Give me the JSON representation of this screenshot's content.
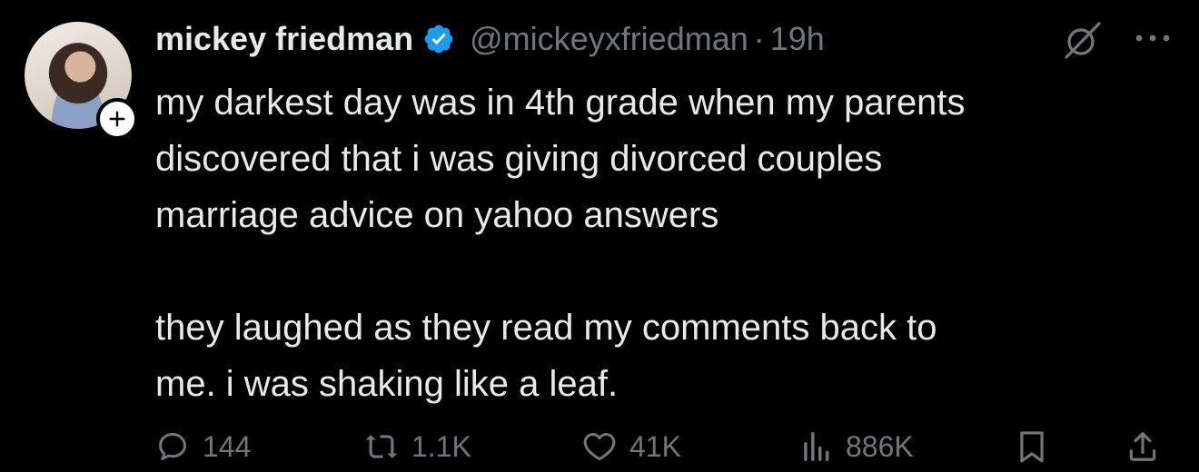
{
  "tweet": {
    "author_name": "mickey friedman",
    "handle": "@mickeyxfriedman",
    "separator": "·",
    "time": "19h",
    "text": "my darkest day was in 4th grade when my parents\ndiscovered that i was giving divorced couples\nmarriage advice on yahoo answers\n\nthey laughed as they read my comments back to\nme. i was shaking like a leaf.",
    "verified_color": "#1d9bf0"
  },
  "actions": {
    "replies": "144",
    "reposts": "1.1K",
    "likes": "41K",
    "views": "886K"
  },
  "colors": {
    "background": "#000000",
    "text_primary": "#e7e9ea",
    "text_secondary": "#71767b",
    "accent": "#1d9bf0"
  },
  "icons": [
    "follow-plus-icon",
    "verified-badge-icon",
    "grok-icon",
    "more-icon",
    "reply-icon",
    "repost-icon",
    "like-icon",
    "views-icon",
    "bookmark-icon",
    "share-icon"
  ]
}
